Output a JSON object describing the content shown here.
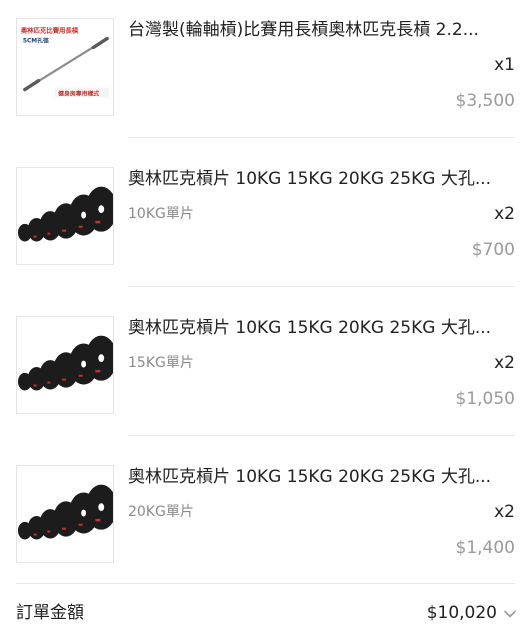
{
  "items": [
    {
      "title": "台灣製(輪軸槓)比賽用長槓奧林匹克長槓 2.2...",
      "variant": "",
      "qty": "x1",
      "price": "$3,500",
      "thumb_icon": "barbell-bar-image",
      "thumb_text_top": "奧林匹克比賽用長槓",
      "thumb_text_mid": "5CM孔徑",
      "thumb_text_bottom": "健身房專用樣式"
    },
    {
      "title": "奧林匹克槓片 10KG 15KG 20KG 25KG 大孔...",
      "variant": "10KG單片",
      "qty": "x2",
      "price": "$700",
      "thumb_icon": "weight-plates-image"
    },
    {
      "title": "奧林匹克槓片 10KG 15KG 20KG 25KG 大孔...",
      "variant": "15KG單片",
      "qty": "x2",
      "price": "$1,050",
      "thumb_icon": "weight-plates-image"
    },
    {
      "title": "奧林匹克槓片 10KG 15KG 20KG 25KG 大孔...",
      "variant": "20KG單片",
      "qty": "x2",
      "price": "$1,400",
      "thumb_icon": "weight-plates-image"
    }
  ],
  "order_total": {
    "label": "訂單金額",
    "value": "$10,020",
    "icon": "chevron-down-icon"
  },
  "colors": {
    "plate_black": "#1c1c1c",
    "plate_red": "#c8322c",
    "price_gray": "#9a9a9a",
    "variant_gray": "#8a8a8a"
  }
}
